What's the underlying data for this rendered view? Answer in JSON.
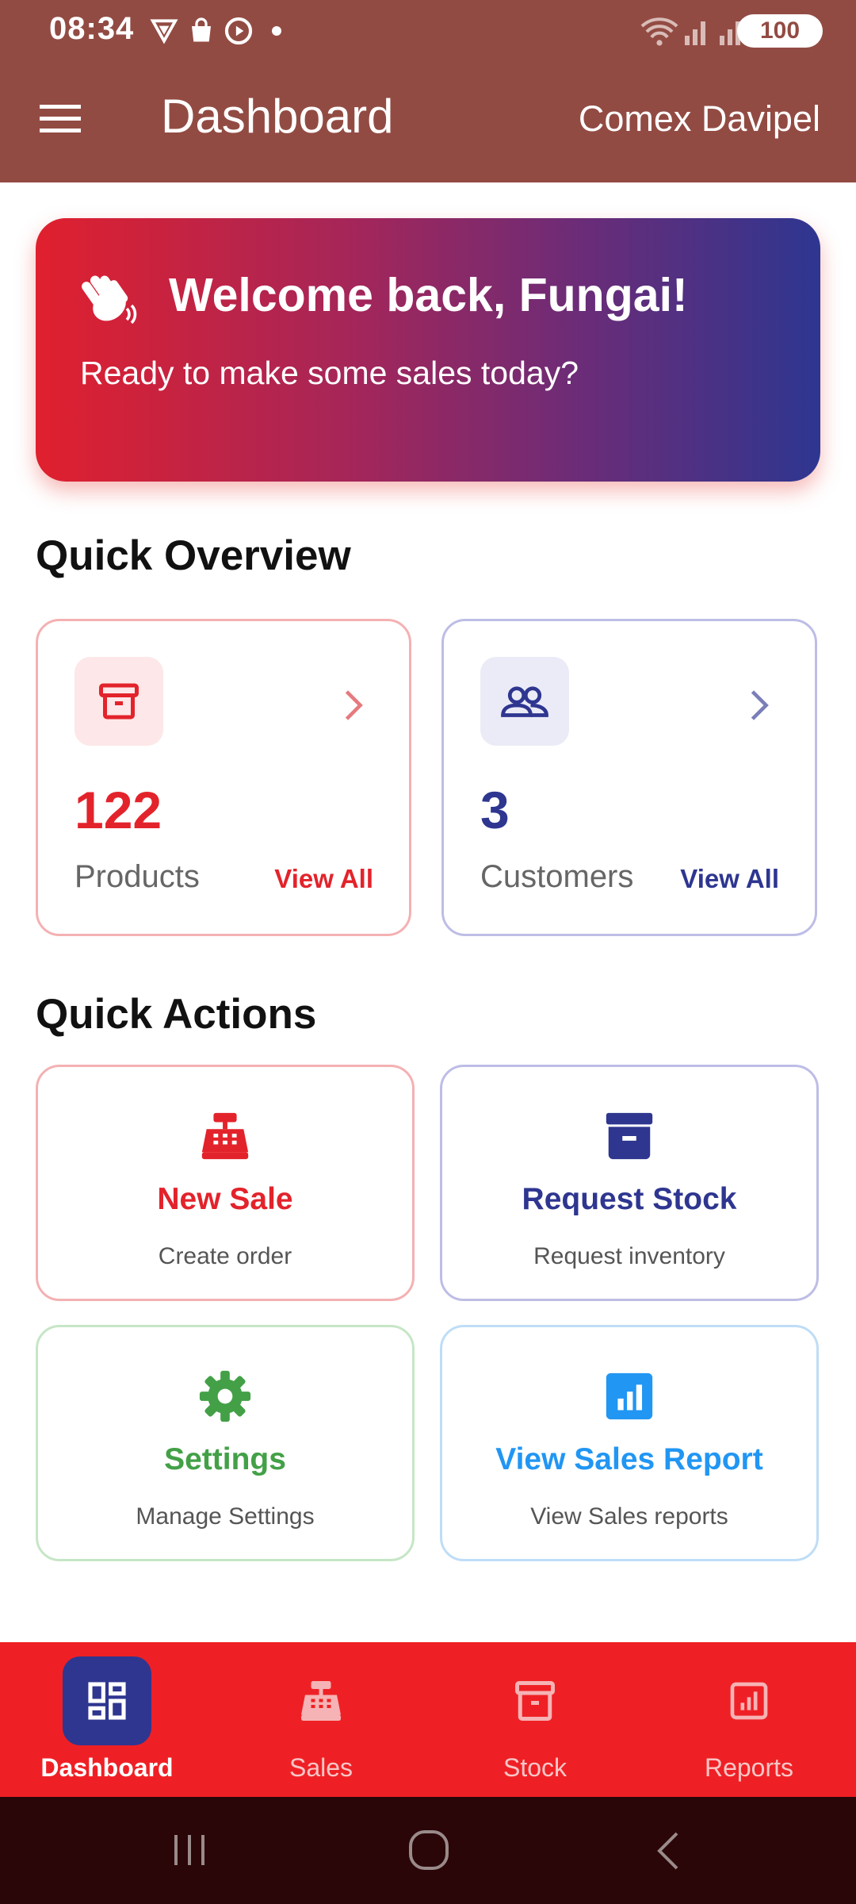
{
  "status_bar": {
    "time": "08:34",
    "battery": "100"
  },
  "app_bar": {
    "title": "Dashboard",
    "org_name": "Comex Davipel"
  },
  "banner": {
    "title": "Welcome back, Fungai!",
    "subtitle": "Ready to make some sales today?"
  },
  "overview": {
    "title": "Quick Overview",
    "products": {
      "count": "122",
      "label": "Products",
      "link": "View All"
    },
    "customers": {
      "count": "3",
      "label": "Customers",
      "link": "View All"
    }
  },
  "actions": {
    "title": "Quick Actions",
    "new_sale": {
      "title": "New Sale",
      "subtitle": "Create order"
    },
    "request_stock": {
      "title": "Request Stock",
      "subtitle": "Request inventory"
    },
    "settings": {
      "title": "Settings",
      "subtitle": "Manage Settings"
    },
    "sales_report": {
      "title": "View Sales Report",
      "subtitle": "View Sales reports"
    }
  },
  "bottom_nav": [
    {
      "label": "Dashboard",
      "icon": "dashboard-icon",
      "active": true
    },
    {
      "label": "Sales",
      "icon": "cash-register-icon",
      "active": false
    },
    {
      "label": "Stock",
      "icon": "archive-box-icon",
      "active": false
    },
    {
      "label": "Reports",
      "icon": "report-chart-icon",
      "active": false
    }
  ],
  "colors": {
    "app_bar": "#924B43",
    "primary_red": "#E3232B",
    "primary_blue": "#2E3690",
    "green": "#43A047",
    "light_blue": "#2196F3",
    "nav_bg": "#EF2025"
  }
}
